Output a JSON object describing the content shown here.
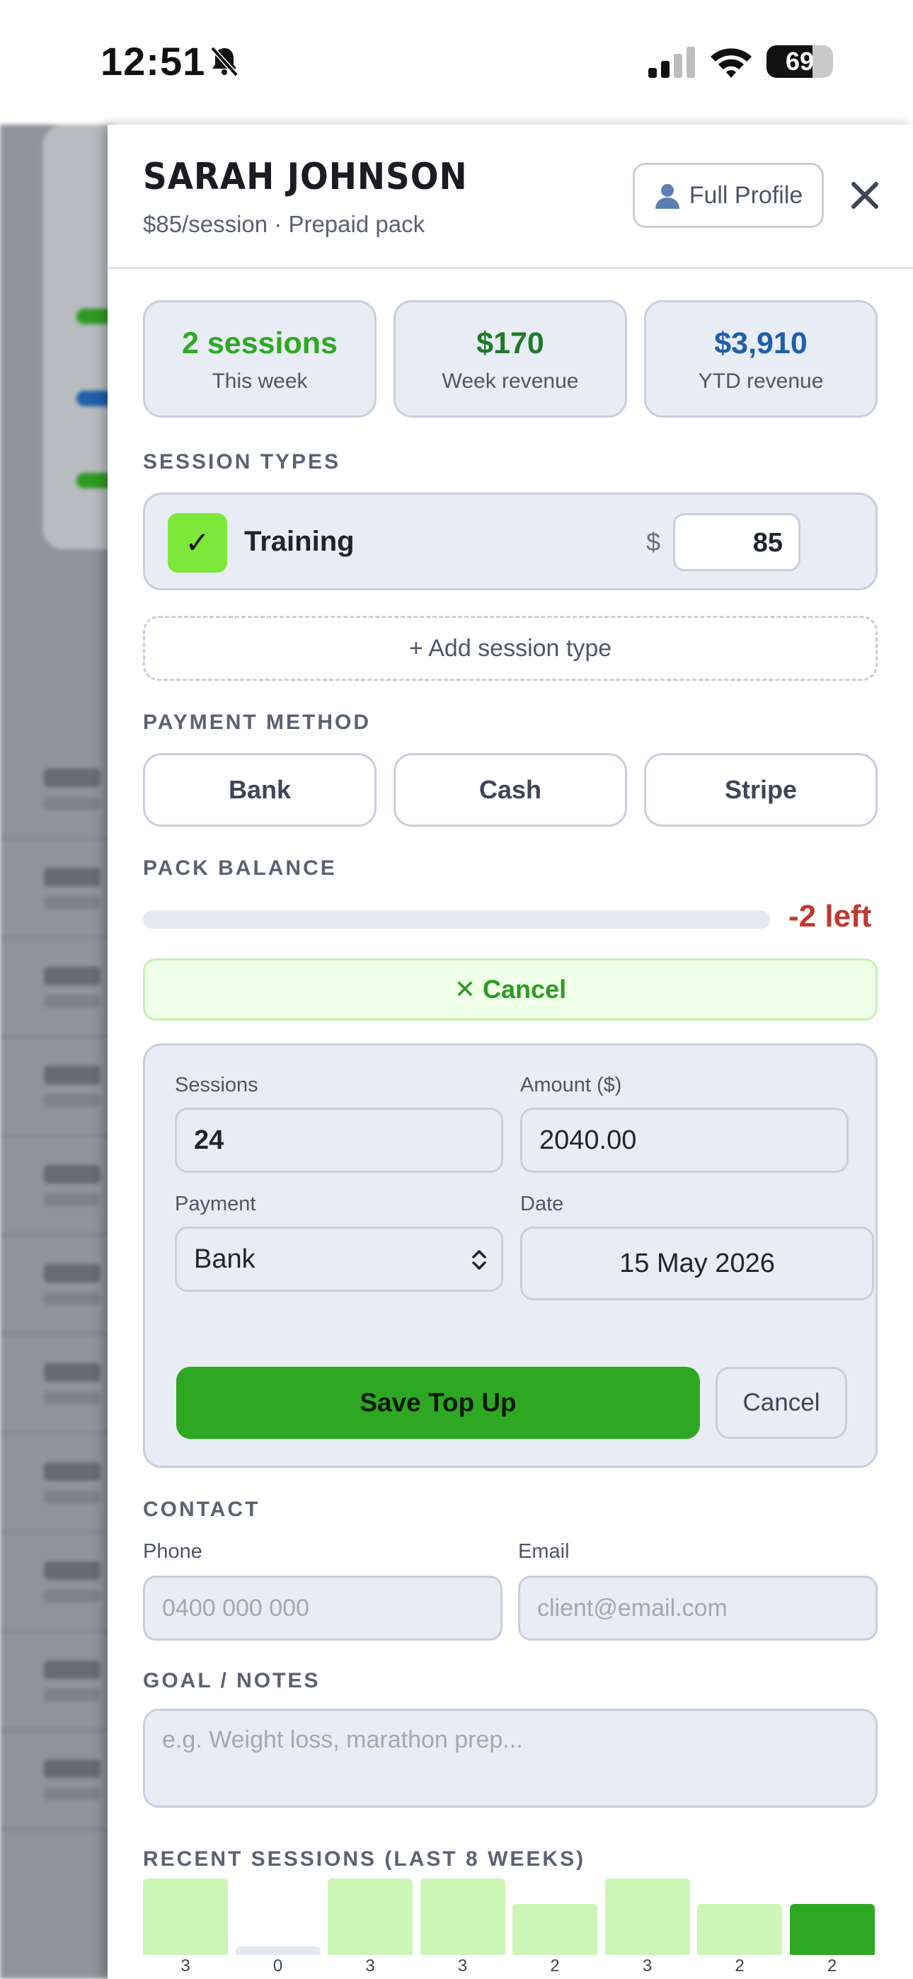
{
  "status_bar": {
    "time": "12:51",
    "battery_percent": "69",
    "battery_level": 0.69
  },
  "client": {
    "name": "SARAH JOHNSON",
    "subtitle": "$85/session · Prepaid pack",
    "full_profile_label": "Full Profile",
    "profile_icon": "user-icon",
    "close_icon": "close-icon"
  },
  "stats": [
    {
      "value": "2 sessions",
      "label": "This week",
      "color": "#2ea822"
    },
    {
      "value": "$170",
      "label": "Week revenue",
      "color": "#1f7a2a"
    },
    {
      "value": "$3,910",
      "label": "YTD revenue",
      "color": "#1e5fa8"
    }
  ],
  "session_types": {
    "heading": "SESSION TYPES",
    "items": [
      {
        "checked": true,
        "check_mark": "✓",
        "name": "Training",
        "currency": "$",
        "price": "85"
      }
    ],
    "add_label": "+ Add session type"
  },
  "payment_method": {
    "heading": "PAYMENT METHOD",
    "options": [
      "Bank",
      "Cash",
      "Stripe"
    ]
  },
  "pack_balance": {
    "heading": "PACK BALANCE",
    "remaining_label": "-2 left",
    "fill_fraction": 0.0,
    "cancel_label": "✕ Cancel"
  },
  "top_up": {
    "sessions_label": "Sessions",
    "sessions_value": "24",
    "amount_label": "Amount ($)",
    "amount_value": "2040.00",
    "payment_label": "Payment",
    "payment_value": "Bank",
    "date_label": "Date",
    "date_value": "15 May 2026",
    "save_label": "Save Top Up",
    "cancel_label": "Cancel"
  },
  "contact": {
    "heading": "CONTACT",
    "phone_label": "Phone",
    "phone_placeholder": "0400 000 000",
    "email_label": "Email",
    "email_placeholder": "client@email.com"
  },
  "goal_notes": {
    "heading": "GOAL / NOTES",
    "placeholder": "e.g. Weight loss, marathon prep..."
  },
  "recent_sessions": {
    "heading": "RECENT SESSIONS (LAST 8 WEEKS)",
    "values": [
      3,
      0,
      3,
      3,
      2,
      3,
      2,
      2
    ],
    "current_week_index": 7,
    "bar_color": "#ccf5b8",
    "current_color": "#2ea822",
    "empty_color": "#e3e8f1"
  }
}
